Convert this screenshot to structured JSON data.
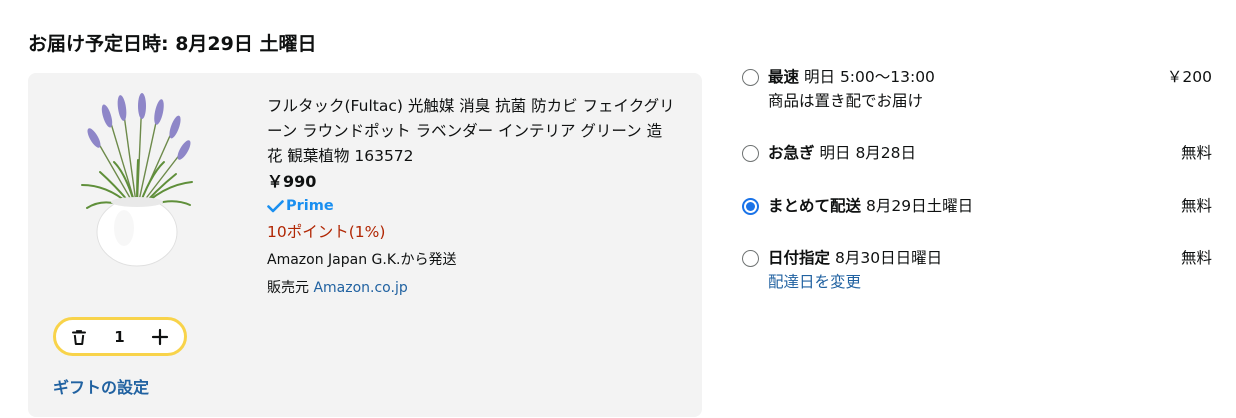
{
  "delivery": {
    "heading": "お届け予定日時: 8月29日 土曜日"
  },
  "item": {
    "image_icon": "lavender-potted-plant",
    "title": "フルタック(Fultac) 光触媒 消臭 抗菌 防カビ フェイクグリーン ラウンドポット ラベンダー インテリア グリーン 造花 観葉植物 163572",
    "price": "￥990",
    "prime_label": "Prime",
    "points": "10ポイント(1%)",
    "ships_from": "Amazon Japan G.K.から発送",
    "seller_prefix": "販売元 ",
    "seller_name": "Amazon.co.jp",
    "quantity": "1",
    "gift_label": "ギフトの設定"
  },
  "shipping_options": [
    {
      "name": "最速",
      "date": "明日 5:00〜13:00",
      "price": "￥200",
      "note": "商品は置き配でお届け",
      "selected": false
    },
    {
      "name": "お急ぎ",
      "date": "明日 8月28日",
      "price": "無料",
      "selected": false
    },
    {
      "name": "まとめて配送",
      "date": "8月29日土曜日",
      "price": "無料",
      "selected": true
    },
    {
      "name": "日付指定",
      "date": "8月30日日曜日",
      "price": "無料",
      "link": "配達日を変更",
      "selected": false
    }
  ],
  "colors": {
    "prime": "#1a8ff0",
    "points": "#b12704",
    "link": "#2162a1",
    "stepper_border": "#f8d34a",
    "radio_selected": "#1a73e8"
  }
}
